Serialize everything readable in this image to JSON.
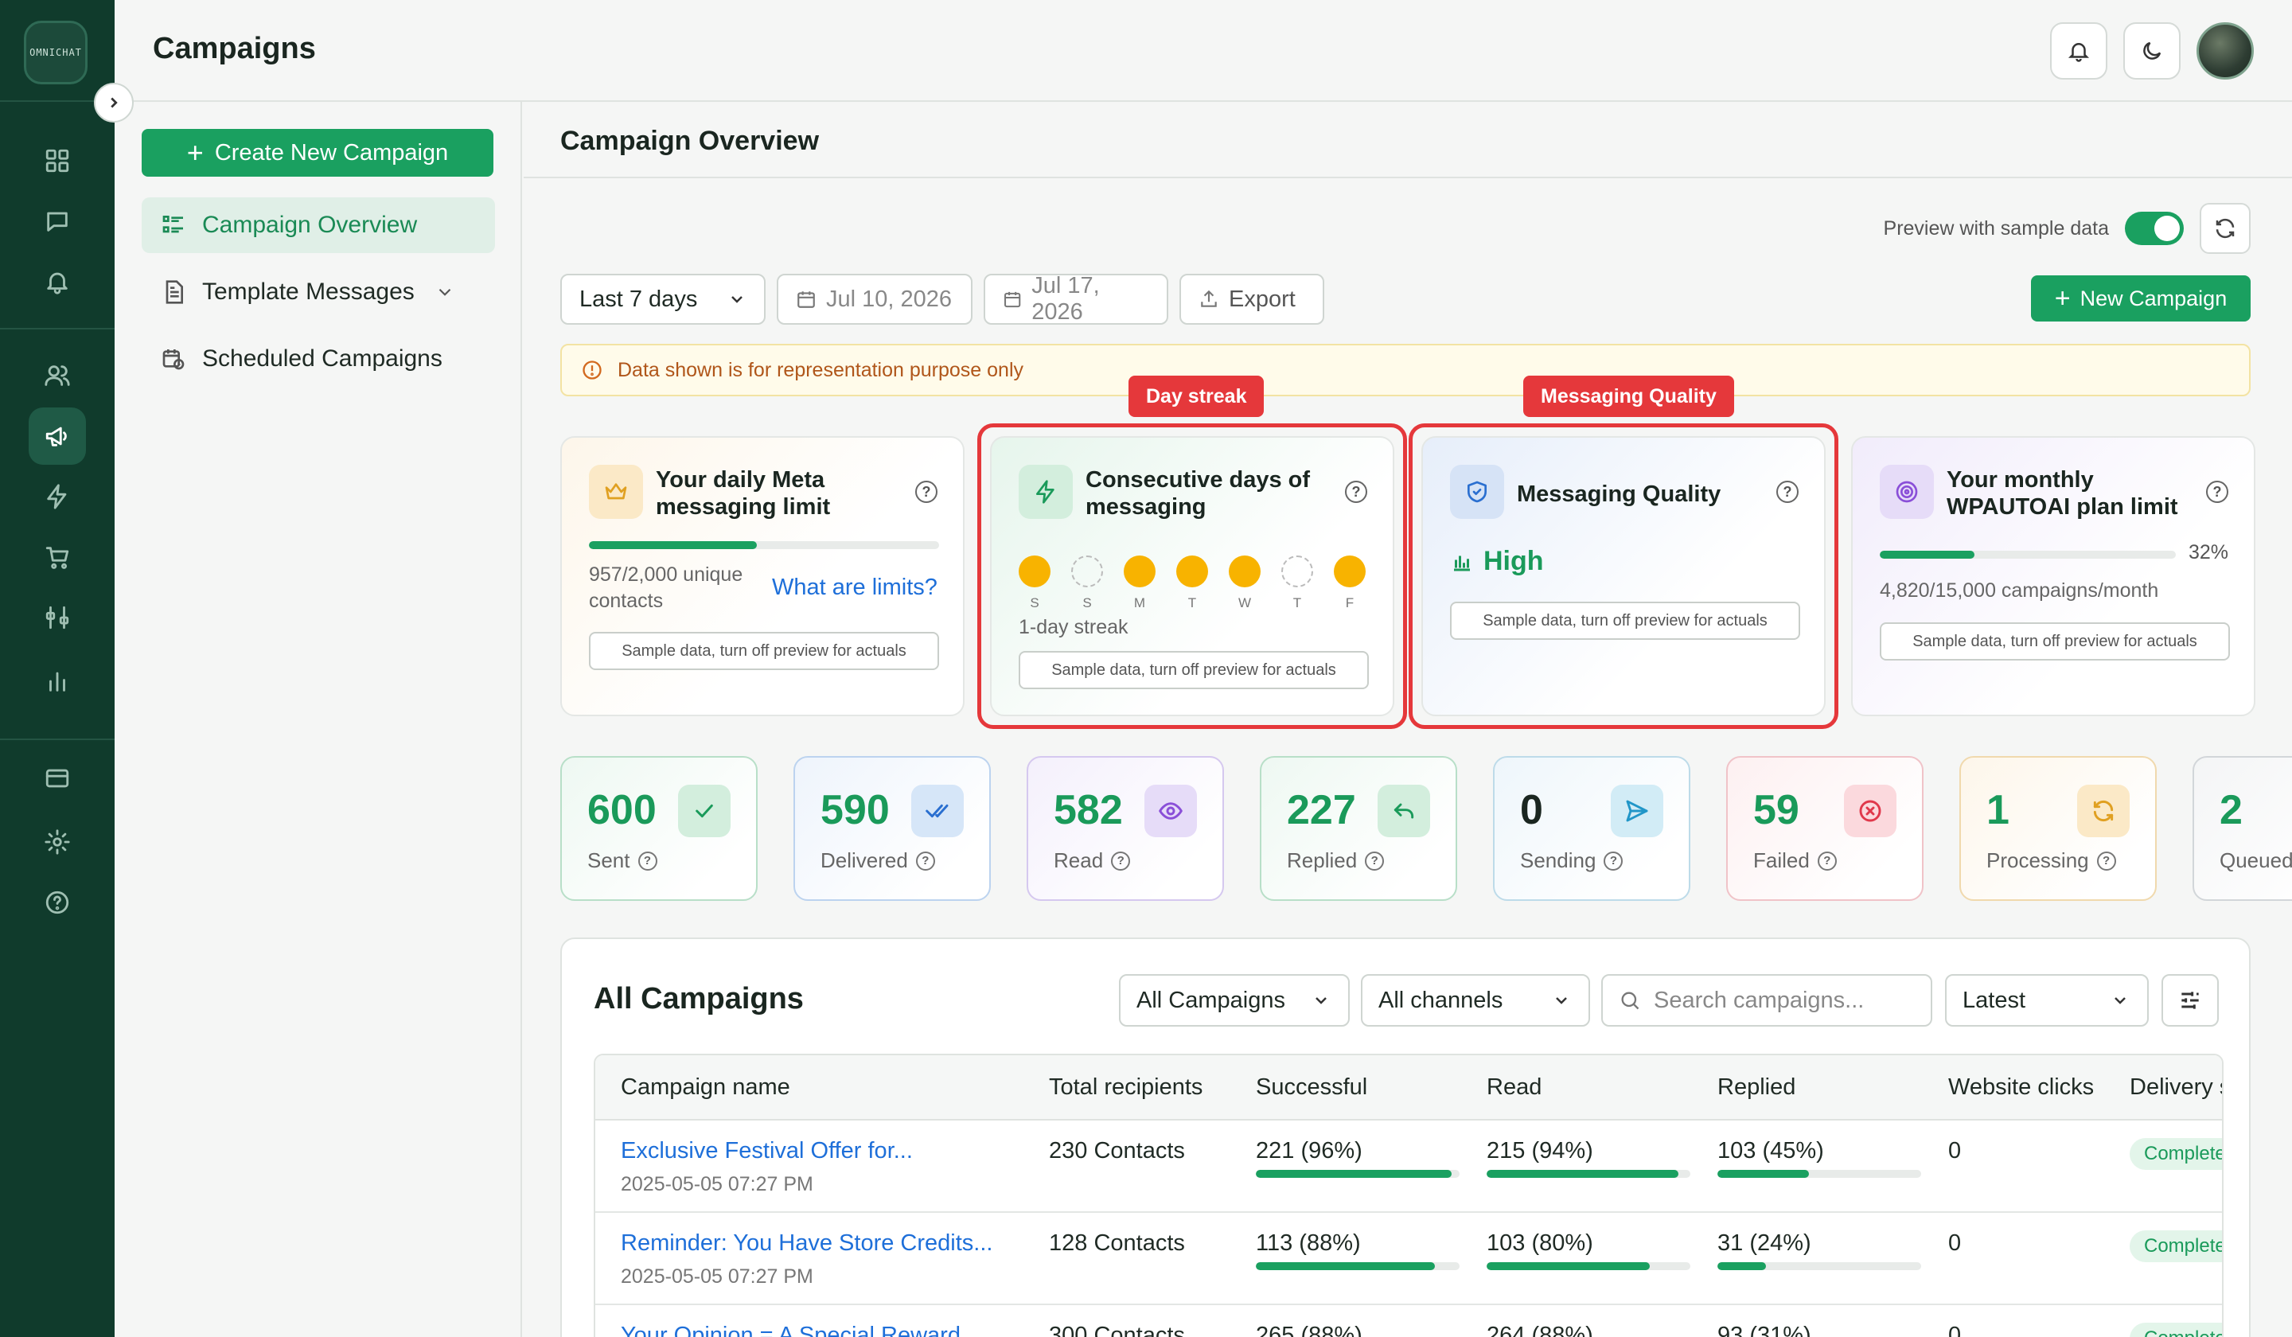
{
  "app": {
    "logo_text": "OMNICHAT",
    "page_title": "Campaigns"
  },
  "sidebar_nav": {
    "create_label": "Create New Campaign",
    "items": [
      {
        "label": "Campaign Overview"
      },
      {
        "label": "Template Messages"
      },
      {
        "label": "Scheduled Campaigns"
      }
    ]
  },
  "main": {
    "title": "Campaign Overview",
    "preview_label": "Preview with sample data",
    "range": "Last 7 days",
    "date_from": "Jul 10, 2026",
    "date_to": "Jul 17, 2026",
    "export_label": "Export",
    "new_campaign_label": "New Campaign",
    "notice": "Data shown is for representation purpose only"
  },
  "highlights": {
    "streak": "Day streak",
    "quality": "Messaging Quality"
  },
  "cards": {
    "limit": {
      "title": "Your daily Meta messaging limit",
      "progress": 0.4785,
      "usage": "957/2,000 unique contacts",
      "link": "What are limits?",
      "sample": "Sample data, turn off preview for actuals"
    },
    "streak": {
      "title": "Consecutive days of messaging",
      "days": [
        {
          "d": "S",
          "active": true
        },
        {
          "d": "S",
          "active": false
        },
        {
          "d": "M",
          "active": true
        },
        {
          "d": "T",
          "active": true
        },
        {
          "d": "W",
          "active": true
        },
        {
          "d": "T",
          "active": false
        },
        {
          "d": "F",
          "active": true
        }
      ],
      "streak_text": "1-day streak",
      "sample": "Sample data, turn off preview for actuals"
    },
    "quality": {
      "title": "Messaging Quality",
      "value": "High",
      "sample": "Sample data, turn off preview for actuals"
    },
    "plan": {
      "title": "Your monthly WPAUTOAI plan limit",
      "percent": "32%",
      "progress": 0.32,
      "usage": "4,820/15,000 campaigns/month",
      "sample": "Sample data, turn off preview for actuals"
    }
  },
  "metrics": [
    {
      "value": "600",
      "label": "Sent",
      "color": "#1a9a5a",
      "bg": "#eef8f2",
      "border": "#b8dfc8",
      "icon": "check-icon"
    },
    {
      "value": "590",
      "label": "Delivered",
      "color": "#1a9a5a",
      "bg": "#eef4fc",
      "border": "#bcd3ef",
      "icon": "double-check-icon"
    },
    {
      "value": "582",
      "label": "Read",
      "color": "#1a9a5a",
      "bg": "#f4f0fc",
      "border": "#d5c8ef",
      "icon": "eye-icon"
    },
    {
      "value": "227",
      "label": "Replied",
      "color": "#1a9a5a",
      "bg": "#eef8f2",
      "border": "#b8dfc8",
      "icon": "reply-icon"
    },
    {
      "value": "0",
      "label": "Sending",
      "color": "#1a2620",
      "bg": "#eef6fb",
      "border": "#bddbe9",
      "icon": "send-icon"
    },
    {
      "value": "59",
      "label": "Failed",
      "color": "#1a9a5a",
      "bg": "#fdf0f1",
      "border": "#f0c3c8",
      "icon": "x-circle-icon"
    },
    {
      "value": "1",
      "label": "Processing",
      "color": "#1a9a5a",
      "bg": "#fdf6ea",
      "border": "#f0d9ad",
      "icon": "refresh-icon"
    },
    {
      "value": "2",
      "label": "Queued",
      "color": "#1a9a5a",
      "bg": "#f4f5f6",
      "border": "#d2d6d9",
      "icon": "layers-icon"
    }
  ],
  "campaigns": {
    "title": "All Campaigns",
    "filter": "All Campaigns",
    "channel": "All channels",
    "search_placeholder": "Search campaigns...",
    "sort": "Latest",
    "columns": [
      "Campaign name",
      "Total recipients",
      "Successful",
      "Read",
      "Replied",
      "Website clicks",
      "Delivery s"
    ],
    "rows": [
      {
        "name": "Exclusive Festival Offer for...",
        "date": "2025-05-05 07:27 PM",
        "recipients": "230 Contacts",
        "successful": "221 (96%)",
        "s_pct": 0.96,
        "read": "215 (94%)",
        "r_pct": 0.94,
        "replied": "103 (45%)",
        "rep_pct": 0.45,
        "clicks": "0",
        "status": "Completed"
      },
      {
        "name": "Reminder: You Have Store Credits...",
        "date": "2025-05-05 07:27 PM",
        "recipients": "128 Contacts",
        "successful": "113 (88%)",
        "s_pct": 0.88,
        "read": "103 (80%)",
        "r_pct": 0.8,
        "replied": "31 (24%)",
        "rep_pct": 0.24,
        "clicks": "0",
        "status": "Completed"
      },
      {
        "name": "Your Opinion = A Special Reward",
        "date": "",
        "recipients": "300 Contacts",
        "successful": "265 (88%)",
        "s_pct": 0.88,
        "read": "264 (88%)",
        "r_pct": 0.88,
        "replied": "93 (31%)",
        "rep_pct": 0.31,
        "clicks": "0",
        "status": "Completed"
      }
    ]
  }
}
